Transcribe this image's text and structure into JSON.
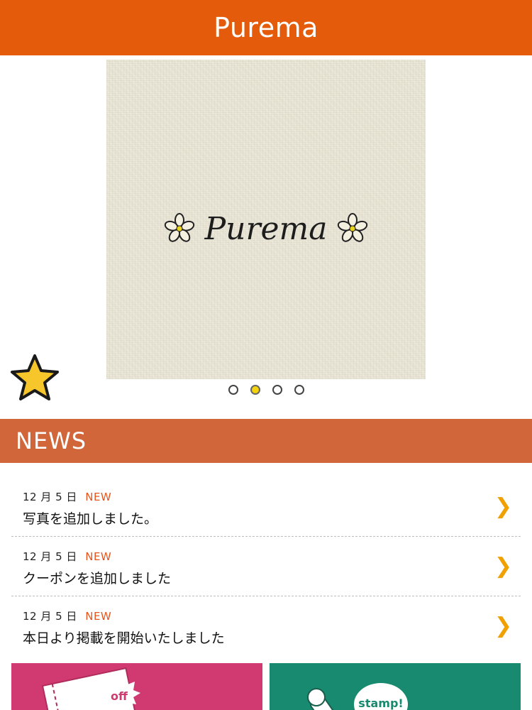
{
  "header": {
    "title": "Purema"
  },
  "carousel": {
    "slide_logo_text": "Purema",
    "dots": 4,
    "active_index": 1
  },
  "news": {
    "title": "NEWS",
    "items": [
      {
        "date": "12 月 5 日",
        "badge": "NEW",
        "text": "写真を追加しました。"
      },
      {
        "date": "12 月 5 日",
        "badge": "NEW",
        "text": "クーポンを追加しました"
      },
      {
        "date": "12 月 5 日",
        "badge": "NEW",
        "text": "本日より掲載を開始いたしました"
      }
    ]
  },
  "tiles": {
    "coupon": {
      "label": "off",
      "icon": "coupon-icon",
      "color": "#d13a70"
    },
    "stamp": {
      "label": "stamp!",
      "icon": "stamp-icon",
      "color": "#178a6f"
    }
  },
  "colors": {
    "header_bg": "#e45b0b",
    "news_bar_bg": "#d0663a",
    "accent_new": "#e8541a",
    "chevron": "#f0a000",
    "dot_active": "#f4d20c"
  }
}
